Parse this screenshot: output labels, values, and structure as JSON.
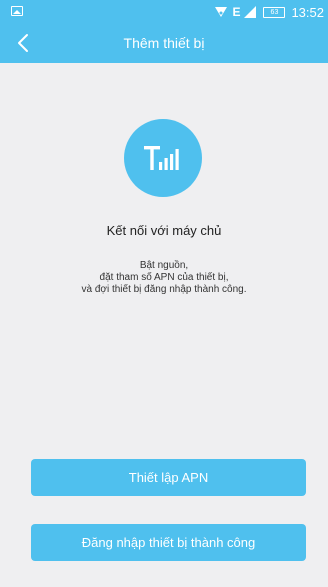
{
  "status_bar": {
    "network_letter": "E",
    "battery_level": "63",
    "time": "13:52",
    "icons": [
      "gallery-icon",
      "wifi-icon",
      "cellular-signal-icon",
      "battery-icon"
    ]
  },
  "header": {
    "title": "Thêm thiết bị",
    "back_icon": "chevron-left-icon"
  },
  "hero": {
    "icon": "antenna-signal-icon"
  },
  "main": {
    "heading": "Kết nối với máy chủ",
    "description_lines": [
      "Bật nguồn,",
      "đặt tham số APN của thiết bị,",
      "và đợi thiết bị đăng nhập thành công."
    ]
  },
  "actions": {
    "setup_apn_label": "Thiết lập APN",
    "login_success_label": "Đăng nhập thiết bị thành công"
  },
  "colors": {
    "accent": "#4fc0ee",
    "background": "#efeff1",
    "text": "#222222"
  }
}
